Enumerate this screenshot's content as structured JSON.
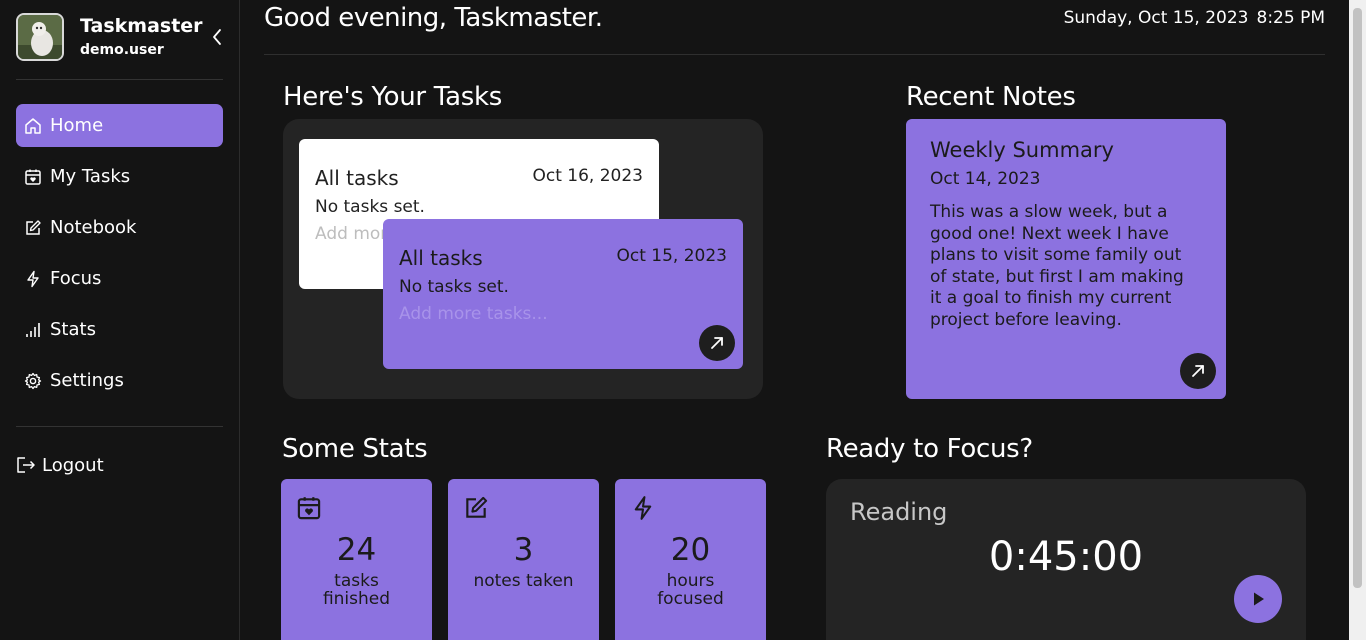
{
  "profile": {
    "name": "Taskmaster",
    "username": "demo.user"
  },
  "nav": {
    "items": [
      {
        "label": "Home",
        "icon": "home-icon",
        "active": true
      },
      {
        "label": "My Tasks",
        "icon": "calendar-heart-icon"
      },
      {
        "label": "Notebook",
        "icon": "edit-icon"
      },
      {
        "label": "Focus",
        "icon": "lightning-icon"
      },
      {
        "label": "Stats",
        "icon": "bar-chart-icon"
      },
      {
        "label": "Settings",
        "icon": "gear-icon"
      }
    ],
    "logout": "Logout"
  },
  "header": {
    "greeting": "Good evening, Taskmaster.",
    "date": "Sunday, Oct 15, 2023",
    "time": "8:25 PM"
  },
  "tasks": {
    "title": "Here's Your Tasks",
    "cards": [
      {
        "title": "All tasks",
        "date": "Oct 16, 2023",
        "status": "No tasks set.",
        "add": "Add more tasks..."
      },
      {
        "title": "All tasks",
        "date": "Oct 15, 2023",
        "status": "No tasks set.",
        "add": "Add more tasks..."
      }
    ]
  },
  "notes": {
    "title": "Recent Notes",
    "card": {
      "title": "Weekly Summary",
      "date": "Oct 14, 2023",
      "body": "This was a slow week, but a good one! Next week I have plans to visit some family out of state, but first I am making it a goal to finish my current project before leaving."
    }
  },
  "stats": {
    "title": "Some Stats",
    "items": [
      {
        "value": "24",
        "label": "tasks finished",
        "icon": "calendar-heart-icon"
      },
      {
        "value": "3",
        "label": "notes taken",
        "icon": "edit-icon"
      },
      {
        "value": "20",
        "label": "hours focused",
        "icon": "lightning-icon"
      }
    ]
  },
  "focus": {
    "title": "Ready to Focus?",
    "label": "Reading",
    "timer": "0:45:00"
  },
  "colors": {
    "accent": "#8c72e0",
    "background": "#141414",
    "panel": "#242424"
  }
}
